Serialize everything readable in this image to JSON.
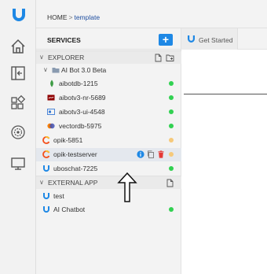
{
  "app": {
    "logo": "ubos-logo-icon"
  },
  "activity_bar": {
    "items": [
      {
        "icon": "home-icon"
      },
      {
        "icon": "panel-collapse-icon"
      },
      {
        "icon": "extensions-icon"
      },
      {
        "icon": "settings-gear-icon"
      },
      {
        "icon": "monitor-icon"
      }
    ]
  },
  "breadcrumb": {
    "root": "HOME",
    "separator": ">",
    "current": "template"
  },
  "services": {
    "title": "SERVICES",
    "add_label": "+",
    "explorer": {
      "label": "EXPLORER",
      "group": {
        "label": "AI Bot 3.0 Beta",
        "children": [
          {
            "label": "aibotdb-1215",
            "icon": "mongodb-leaf-icon",
            "status": "green"
          },
          {
            "label": "aibotv3-nr-5689",
            "icon": "node-red-icon",
            "status": "green"
          },
          {
            "label": "aibotv3-ui-4548",
            "icon": "web-ui-icon",
            "status": "green"
          },
          {
            "label": "vectordb-5975",
            "icon": "vector-db-icon",
            "status": "green"
          }
        ]
      },
      "items": [
        {
          "label": "opik-5851",
          "icon": "opik-icon",
          "status": "amber"
        },
        {
          "label": "opik-testserver",
          "icon": "opik-icon",
          "status": "amber",
          "selected": true
        },
        {
          "label": "uboschat-7225",
          "icon": "ubos-icon",
          "status": "green"
        }
      ]
    },
    "external": {
      "label": "EXTERNAL APP",
      "items": [
        {
          "label": "test",
          "icon": "ubos-icon"
        },
        {
          "label": "AI Chatbot",
          "icon": "ubos-icon",
          "status": "green"
        }
      ]
    }
  },
  "tabs": [
    {
      "label": "Get Started",
      "icon": "ubos-logo-icon"
    }
  ],
  "colors": {
    "accent": "#1e88e5",
    "running": "#31d151",
    "pending": "#f6c97a",
    "delete": "#e53935"
  }
}
